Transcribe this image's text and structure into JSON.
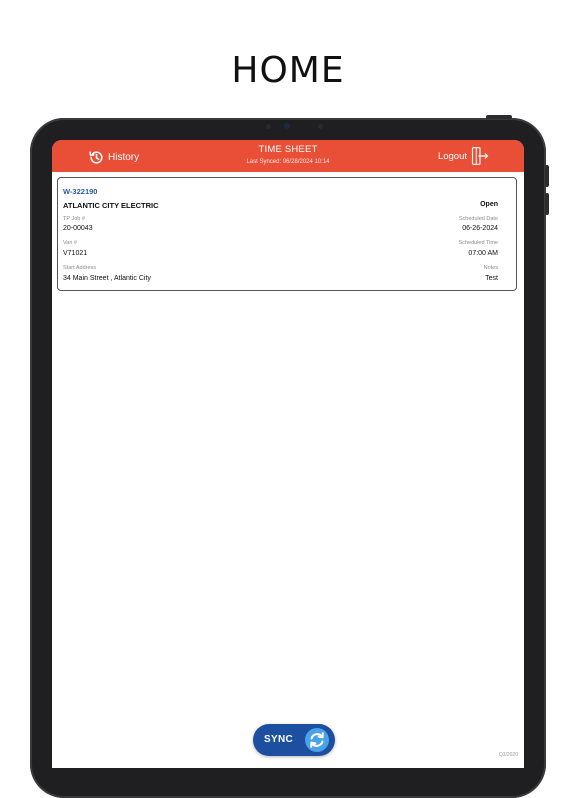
{
  "heading": "HOME",
  "header": {
    "history_label": "History",
    "title": "TIME SHEET",
    "last_synced": "Last Synced: 06/28/2024 10:14",
    "logout_label": "Logout"
  },
  "job": {
    "id": "W-322190",
    "customer": "ATLANTIC CITY ELECTRIC",
    "status": "Open",
    "tp_job_label": "TP Job #",
    "tp_job_value": "20-00043",
    "scheduled_date_label": "Scheduled Date",
    "scheduled_date_value": "06-26-2024",
    "van_label": "Van #",
    "van_value": "V71021",
    "scheduled_time_label": "Scheduled Time",
    "scheduled_time_value": "07:00 AM",
    "start_address_label": "Start Address",
    "start_address_value": "34 Main Street , Atlantic City",
    "notes_label": "Notes",
    "notes_value": "Test"
  },
  "sync": {
    "label": "SYNC"
  },
  "version": "Q3/2020",
  "colors": {
    "header_bg": "#e94e36",
    "job_id": "#2f5aa8",
    "sync_bg": "#1d4fa1",
    "tablet_frame": "#1f1f21"
  },
  "icons": {
    "history": "history-clock-icon",
    "logout": "logout-door-icon",
    "sync": "sync-arrows-icon"
  }
}
